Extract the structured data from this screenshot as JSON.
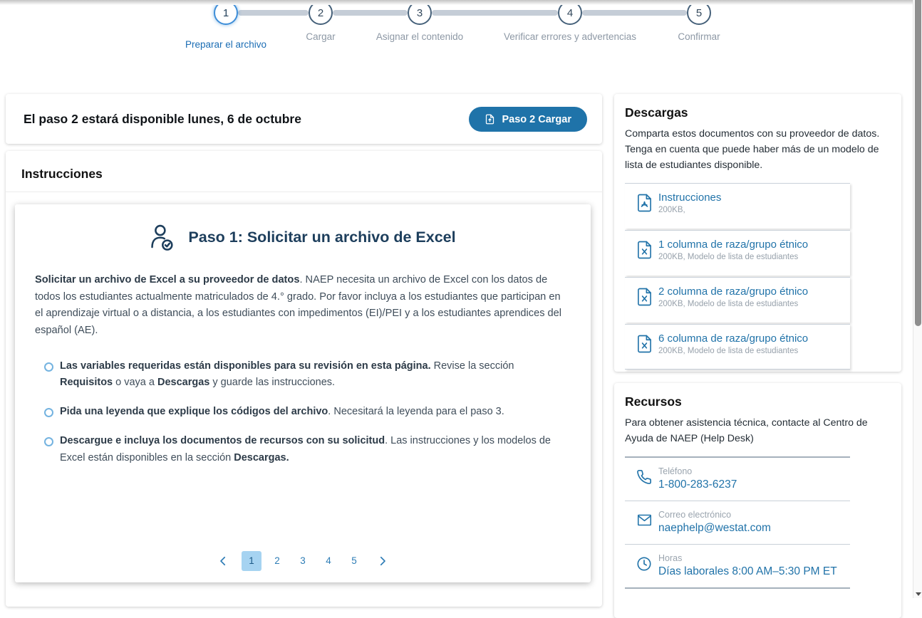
{
  "colors": {
    "accent_blue": "#2173a9",
    "navy": "#1d3e5c",
    "active_step_blue": "#1b6db4",
    "pagination_active_bg": "#a6d3f1"
  },
  "stepper": {
    "steps": [
      {
        "number": "1",
        "label": "Preparar el archivo",
        "active": true
      },
      {
        "number": "2",
        "label": "Cargar",
        "active": false
      },
      {
        "number": "3",
        "label": "Asignar el contenido",
        "active": false
      },
      {
        "number": "4",
        "label": "Verificar errores y advertencias",
        "active": false
      },
      {
        "number": "5",
        "label": "Confirmar",
        "active": false
      }
    ]
  },
  "banner": {
    "title": "El paso 2 estará disponible lunes, 6 de octubre",
    "button_label": "Paso 2 Cargar"
  },
  "instructions": {
    "section_title": "Instrucciones",
    "step_heading": "Paso 1: Solicitar un archivo de Excel",
    "intro": {
      "bold": "Solicitar un archivo de Excel a su proveedor de datos",
      "rest": ". NAEP necesita un archivo de Excel con los datos de todos los estudiantes actualmente matriculados de 4.° grado. Por favor incluya a los estudiantes que participan en el aprendizaje virtual o a distancia, a los estudiantes con impedimentos (EI)/PEI y a los estudiantes aprendices del español (AE)."
    },
    "bullets": [
      {
        "segments": [
          {
            "t": "Las variables requeridas están disponibles para su revisión en esta página."
          },
          {
            "t": " Revise la sección "
          },
          {
            "t": "Requisitos"
          },
          {
            "t": " o vaya a "
          },
          {
            "t": "Descargas"
          },
          {
            "t": " y guarde las instrucciones."
          }
        ]
      },
      {
        "segments": [
          {
            "t": "Pida una leyenda que explique los códigos del archivo"
          },
          {
            "t": ". Necesitará la leyenda para el paso 3."
          }
        ]
      },
      {
        "segments": [
          {
            "t": "Descargue e incluya los documentos de recursos con su solicitud"
          },
          {
            "t": ". Las instrucciones y los modelos de Excel están disponibles en la sección "
          },
          {
            "t": "Descargas."
          }
        ]
      }
    ],
    "pagination": {
      "pages": [
        "1",
        "2",
        "3",
        "4",
        "5"
      ],
      "active_page": "1"
    }
  },
  "downloads": {
    "title": "Descargas",
    "description": "Comparta estos documentos con su proveedor de datos. Tenga en cuenta que puede haber más de un modelo de lista de estudiantes disponible.",
    "items": [
      {
        "icon": "pdf-file-icon",
        "title": "Instrucciones",
        "meta": "200KB,"
      },
      {
        "icon": "excel-file-icon",
        "title": "1 columna de raza/grupo étnico",
        "meta": "200KB, Modelo de lista de estudiantes"
      },
      {
        "icon": "excel-file-icon",
        "title": "2 columna de raza/grupo étnico",
        "meta": "200KB, Modelo de lista de estudiantes"
      },
      {
        "icon": "excel-file-icon",
        "title": "6 columna de raza/grupo étnico",
        "meta": "200KB, Modelo de lista de estudiantes"
      }
    ]
  },
  "resources": {
    "title": "Recursos",
    "description": "Para obtener asistencia técnica, contacte al Centro de Ayuda de NAEP (Help Desk)",
    "contacts": [
      {
        "icon": "phone-icon",
        "label": "Teléfono",
        "value": "1-800-283-6237"
      },
      {
        "icon": "email-icon",
        "label": "Correo electrónico",
        "value": "naephelp@westat.com"
      },
      {
        "icon": "clock-icon",
        "label": "Horas",
        "value": "Días laborales 8:00 AM–5:30 PM ET"
      }
    ]
  }
}
